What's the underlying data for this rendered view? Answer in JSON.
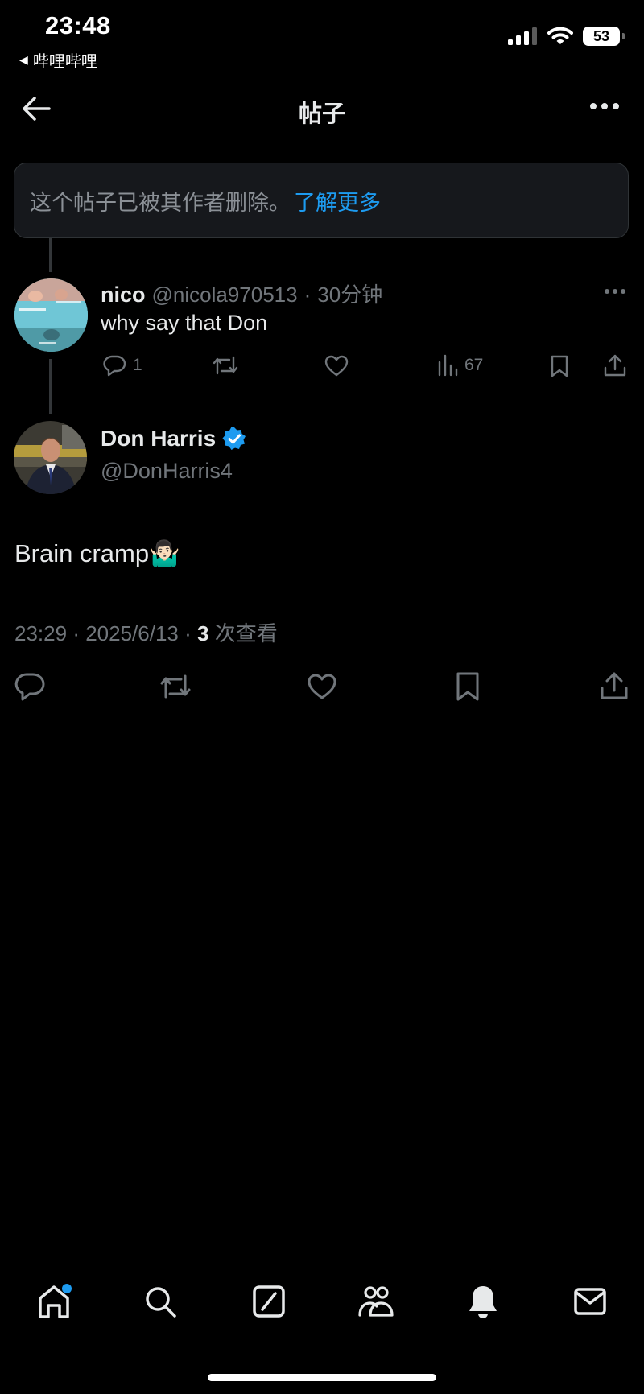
{
  "status_bar": {
    "time": "23:48",
    "back_app": "哔哩哔哩",
    "battery": "53"
  },
  "nav": {
    "title": "帖子"
  },
  "notice": {
    "text": "这个帖子已被其作者删除。",
    "link": "了解更多"
  },
  "reply": {
    "name": "nico",
    "handle": "@nicola970513",
    "separator": "·",
    "time": "30分钟",
    "text": "why say that Don",
    "reply_count": "1",
    "view_count": "67"
  },
  "main_post": {
    "name": "Don Harris",
    "handle": "@DonHarris4",
    "text": "Brain cramp🤷🏻‍♂️",
    "time": "23:29",
    "date": "2025/6/13",
    "sep": "·",
    "views": "3",
    "views_label": "次查看"
  },
  "colors": {
    "background": "#000000",
    "accent": "#1d9bf0",
    "muted": "#71767b",
    "text": "#e7e9ea"
  }
}
